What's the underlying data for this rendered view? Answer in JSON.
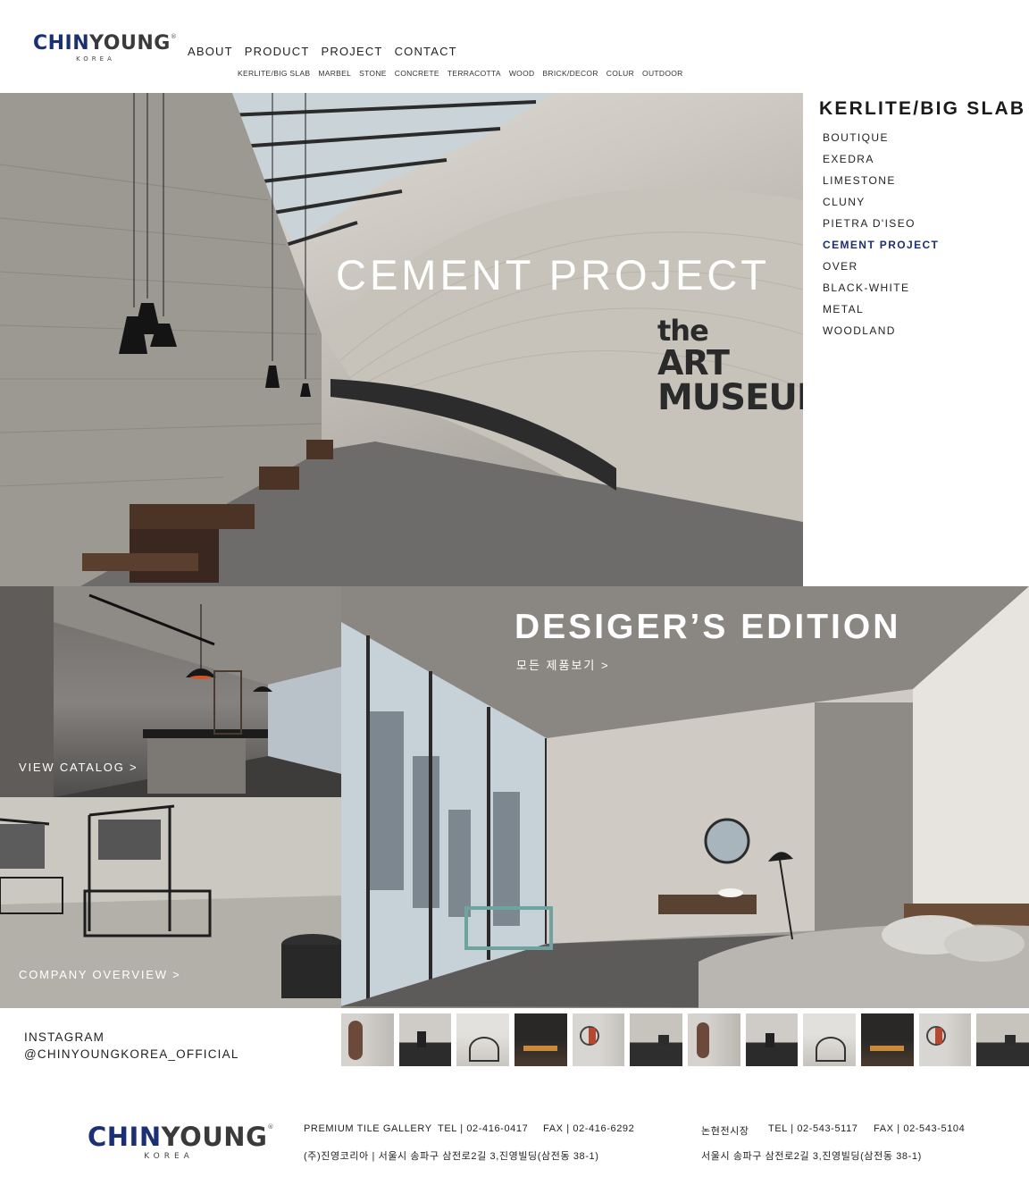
{
  "brand": {
    "name_part1": "CHIN",
    "name_part2": "YOUNG",
    "registered": "®",
    "sub": "KOREA"
  },
  "nav": {
    "main": [
      "ABOUT",
      "PRODUCT",
      "PROJECT",
      "CONTACT"
    ],
    "sub": [
      "KERLITE/BIG SLAB",
      "MARBEL",
      "STONE",
      "CONCRETE",
      "TERRACOTTA",
      "WOOD",
      "BRICK/DECOR",
      "COLUR",
      "OUTDOOR"
    ]
  },
  "hero": {
    "title": "CEMENT PROJECT",
    "sign": [
      "the",
      "ART",
      "MUSEUM"
    ]
  },
  "side_menu": {
    "title": "KERLITE/BIG SLAB",
    "items": [
      "BOUTIQUE",
      "EXEDRA",
      "LIMESTONE",
      "CLUNY",
      "PIETRA D'ISEO",
      "CEMENT PROJECT",
      "OVER",
      "BLACK-WHITE",
      "METAL",
      "WOODLAND"
    ],
    "active": "CEMENT PROJECT",
    "active_color": "#1b2f73"
  },
  "tiles": {
    "catalog_link": "VIEW CATALOG >",
    "company_link": "COMPANY OVERVIEW >",
    "designer_title": "DESIGER’S EDITION",
    "designer_link": "모든 제품보기 >"
  },
  "instagram": {
    "label": "INSTAGRAM",
    "handle": "@CHINYOUNGKOREA_OFFICIAL",
    "thumbs": 12
  },
  "footer": {
    "gallery1": {
      "name": "PREMIUM TILE GALLERY",
      "tel": "TEL | 02-416-0417",
      "fax": "FAX | 02-416-6292",
      "address": "(주)진영코리아 | 서울시 송파구 삼전로2길 3,진영빌딩(삼전동 38-1)"
    },
    "gallery2": {
      "name": "논현전시장",
      "tel": "TEL | 02-543-5117",
      "fax": "FAX | 02-543-5104",
      "address": "서울시 송파구 삼전로2길 3,진영빌딩(삼전동 38-1)"
    }
  },
  "colors": {
    "brand_navy": "#1b2f73",
    "text": "#222222",
    "white": "#ffffff"
  }
}
